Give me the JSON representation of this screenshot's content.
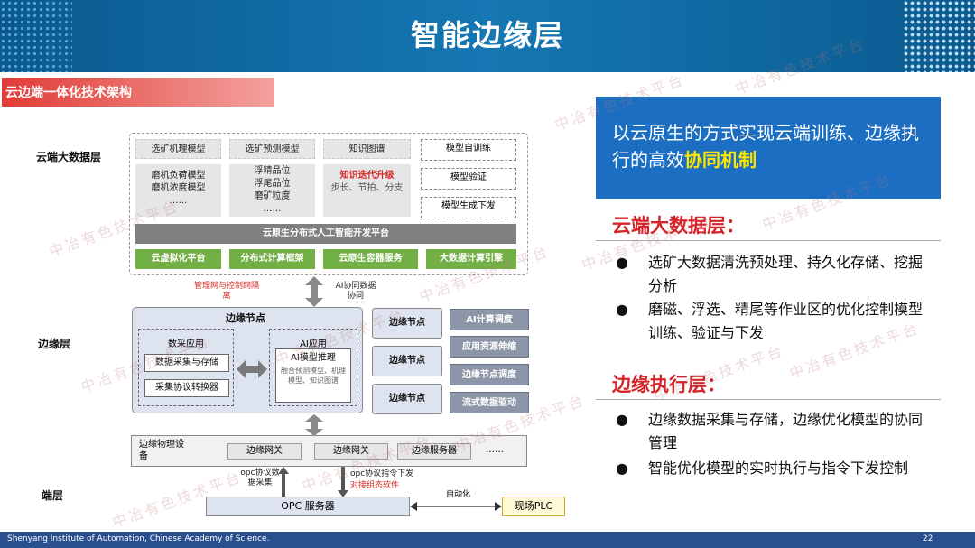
{
  "header": {
    "title": "智能边缘层"
  },
  "section_title": "云边端一体化技术架构",
  "layers": {
    "cloud": "云端大数据层",
    "edge": "边缘层",
    "end": "端层"
  },
  "cloud": {
    "col1": {
      "head": "选矿机理模型",
      "lines": [
        "磨机负荷模型",
        "磨机浓度模型",
        "……"
      ]
    },
    "col2": {
      "head": "选矿预测模型",
      "lines": [
        "浮精品位",
        "浮尾品位",
        "磨矿粒度",
        "……"
      ]
    },
    "col3": {
      "head": "知识图谱",
      "red": "知识迭代升级",
      "gray": "步长、节拍、分支"
    },
    "col4": [
      "模型自训练",
      "模型验证",
      "模型生成下发"
    ],
    "platform": "云原生分布式人工智能开发平台",
    "green_buttons": [
      "云虚拟化平台",
      "分布式计算框架",
      "云原生容器服务",
      "大数据计算引擎"
    ]
  },
  "cloud_edge_link": {
    "left": "管理网与控制网隔离",
    "right": "AI协同数据协同"
  },
  "edge": {
    "node_title": "边缘节点",
    "data_group": {
      "title": "数采应用",
      "items": [
        "数据采集与存储",
        "采集协议转换器"
      ]
    },
    "ai_group": {
      "title": "AI应用",
      "item": "AI模型推理",
      "desc": "融合预测模型、机理模型、知识图谱"
    },
    "side_nodes": [
      "边缘节点",
      "边缘节点",
      "边缘节点"
    ],
    "services": [
      "AI计算调度",
      "应用资源伸缩",
      "边缘节点调度",
      "流式数据驱动"
    ]
  },
  "devices": {
    "label": "边缘物理设备",
    "items": [
      "边缘网关",
      "边缘网关",
      "边缘服务器",
      "……"
    ]
  },
  "end": {
    "left_label": "opc协议数据采集",
    "right_label": "opc协议指令下发",
    "right_red": "对接组态软件",
    "auto": "自动化",
    "opc": "OPC 服务器",
    "plc": "现场PLC"
  },
  "right_panel": {
    "banner_text": "以云原生的方式实现云端训练、边缘执行的高效",
    "banner_highlight": "协同机制",
    "cloud_head": "云端大数据层：",
    "cloud_bullets": [
      "选矿大数据清洗预处理、持久化存储、挖掘分析",
      "磨磁、浮选、精尾等作业区的优化控制模型训练、验证与下发"
    ],
    "edge_head": "边缘执行层：",
    "edge_bullets": [
      "边缘数据采集与存储，边缘优化模型的协同管理",
      "智能优化模型的实时执行与指令下发控制"
    ]
  },
  "footer": {
    "org": "Shenyang Institute of Automation, Chinese Academy of Science.",
    "page": "22"
  },
  "watermark": "中冶有色技术平台",
  "colors": {
    "header_blue": "#1577b3",
    "accent_red": "#d6232a",
    "banner_blue": "#1b6ec2",
    "highlight": "#ffe600",
    "green": "#72b046"
  }
}
